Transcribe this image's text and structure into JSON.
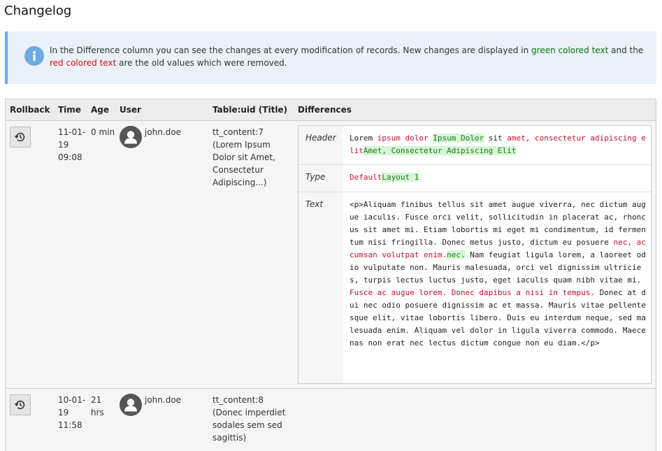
{
  "page": {
    "title": "Changelog"
  },
  "info": {
    "text_before": "In the Difference column you can see the changes at every modification of records. New changes are displayed in ",
    "green_text": "green colored text",
    "text_middle": " and the ",
    "red_text": "red colored text",
    "text_after": " are the old values which were removed."
  },
  "table": {
    "headers": {
      "rollback": "Rollback",
      "time": "Time",
      "age": "Age",
      "user": "User",
      "table_uid": "Table:uid (Title)",
      "differences": "Differences"
    },
    "rows": [
      {
        "time": "11-01-19 09:08",
        "age": "0 min",
        "user": "john.doe",
        "record": "tt_content:7 (Lorem Ipsum Dolor sit Amet, Consectetur Adipiscing...)",
        "diffs": [
          {
            "field": "Header",
            "segments": [
              {
                "t": "same",
                "v": "Lorem "
              },
              {
                "t": "del",
                "v": "ipsum dolor"
              },
              {
                "t": "same",
                "v": " "
              },
              {
                "t": "ins",
                "v": "Ipsum Dolor"
              },
              {
                "t": "same",
                "v": " sit "
              },
              {
                "t": "del",
                "v": "amet, consectetur adipiscing elit"
              },
              {
                "t": "ins",
                "v": "Amet, Consectetur Adipiscing Elit"
              }
            ]
          },
          {
            "field": "Type",
            "segments": [
              {
                "t": "del",
                "v": "Default"
              },
              {
                "t": "ins",
                "v": "Layout 1"
              }
            ]
          },
          {
            "field": "Text",
            "segments": [
              {
                "t": "same",
                "v": "<p>Aliquam finibus tellus sit amet augue viverra, nec dictum augue iaculis. Fusce orci velit, sollicitudin in placerat ac, rhoncus sit amet mi. Etiam lobortis mi eget mi condimentum, id fermentum nisi fringilla. Donec metus justo, dictum eu posuere "
              },
              {
                "t": "del",
                "v": "nec, accumsan volutpat enim."
              },
              {
                "t": "ins",
                "v": "nec."
              },
              {
                "t": "same",
                "v": " Nam feugiat ligula lorem, a laoreet odio vulputate non. Mauris malesuada, orci vel dignissim ultricies, turpis lectus luctus justo, eget iaculis quam nibh vitae mi. "
              },
              {
                "t": "del",
                "v": "Fusce ac augue lorem. Donec dapibus a nisi in tempus."
              },
              {
                "t": "same",
                "v": " Donec at dui nec odio posuere dignissim ac et massa. Mauris vitae pellentesque elit, vitae lobortis libero. Duis eu interdum neque, sed malesuada enim. Aliquam vel dolor in ligula viverra commodo. Maecenas non erat nec lectus dictum congue non eu diam.</p>"
              }
            ]
          }
        ]
      },
      {
        "time": "10-01-19 11:58",
        "age": "21 hrs",
        "user": "john.doe",
        "record": "tt_content:8 (Donec imperdiet sodales sem sed sagittis)",
        "diffs": []
      }
    ]
  },
  "icons": {
    "info": "info-icon",
    "rollback": "history-icon",
    "avatar": "user-avatar-icon"
  },
  "colors": {
    "info_background": "#eaf1f9",
    "info_accent": "#6daae0",
    "inserted_text": "#1f7a1f",
    "removed_text": "#c8102e"
  }
}
